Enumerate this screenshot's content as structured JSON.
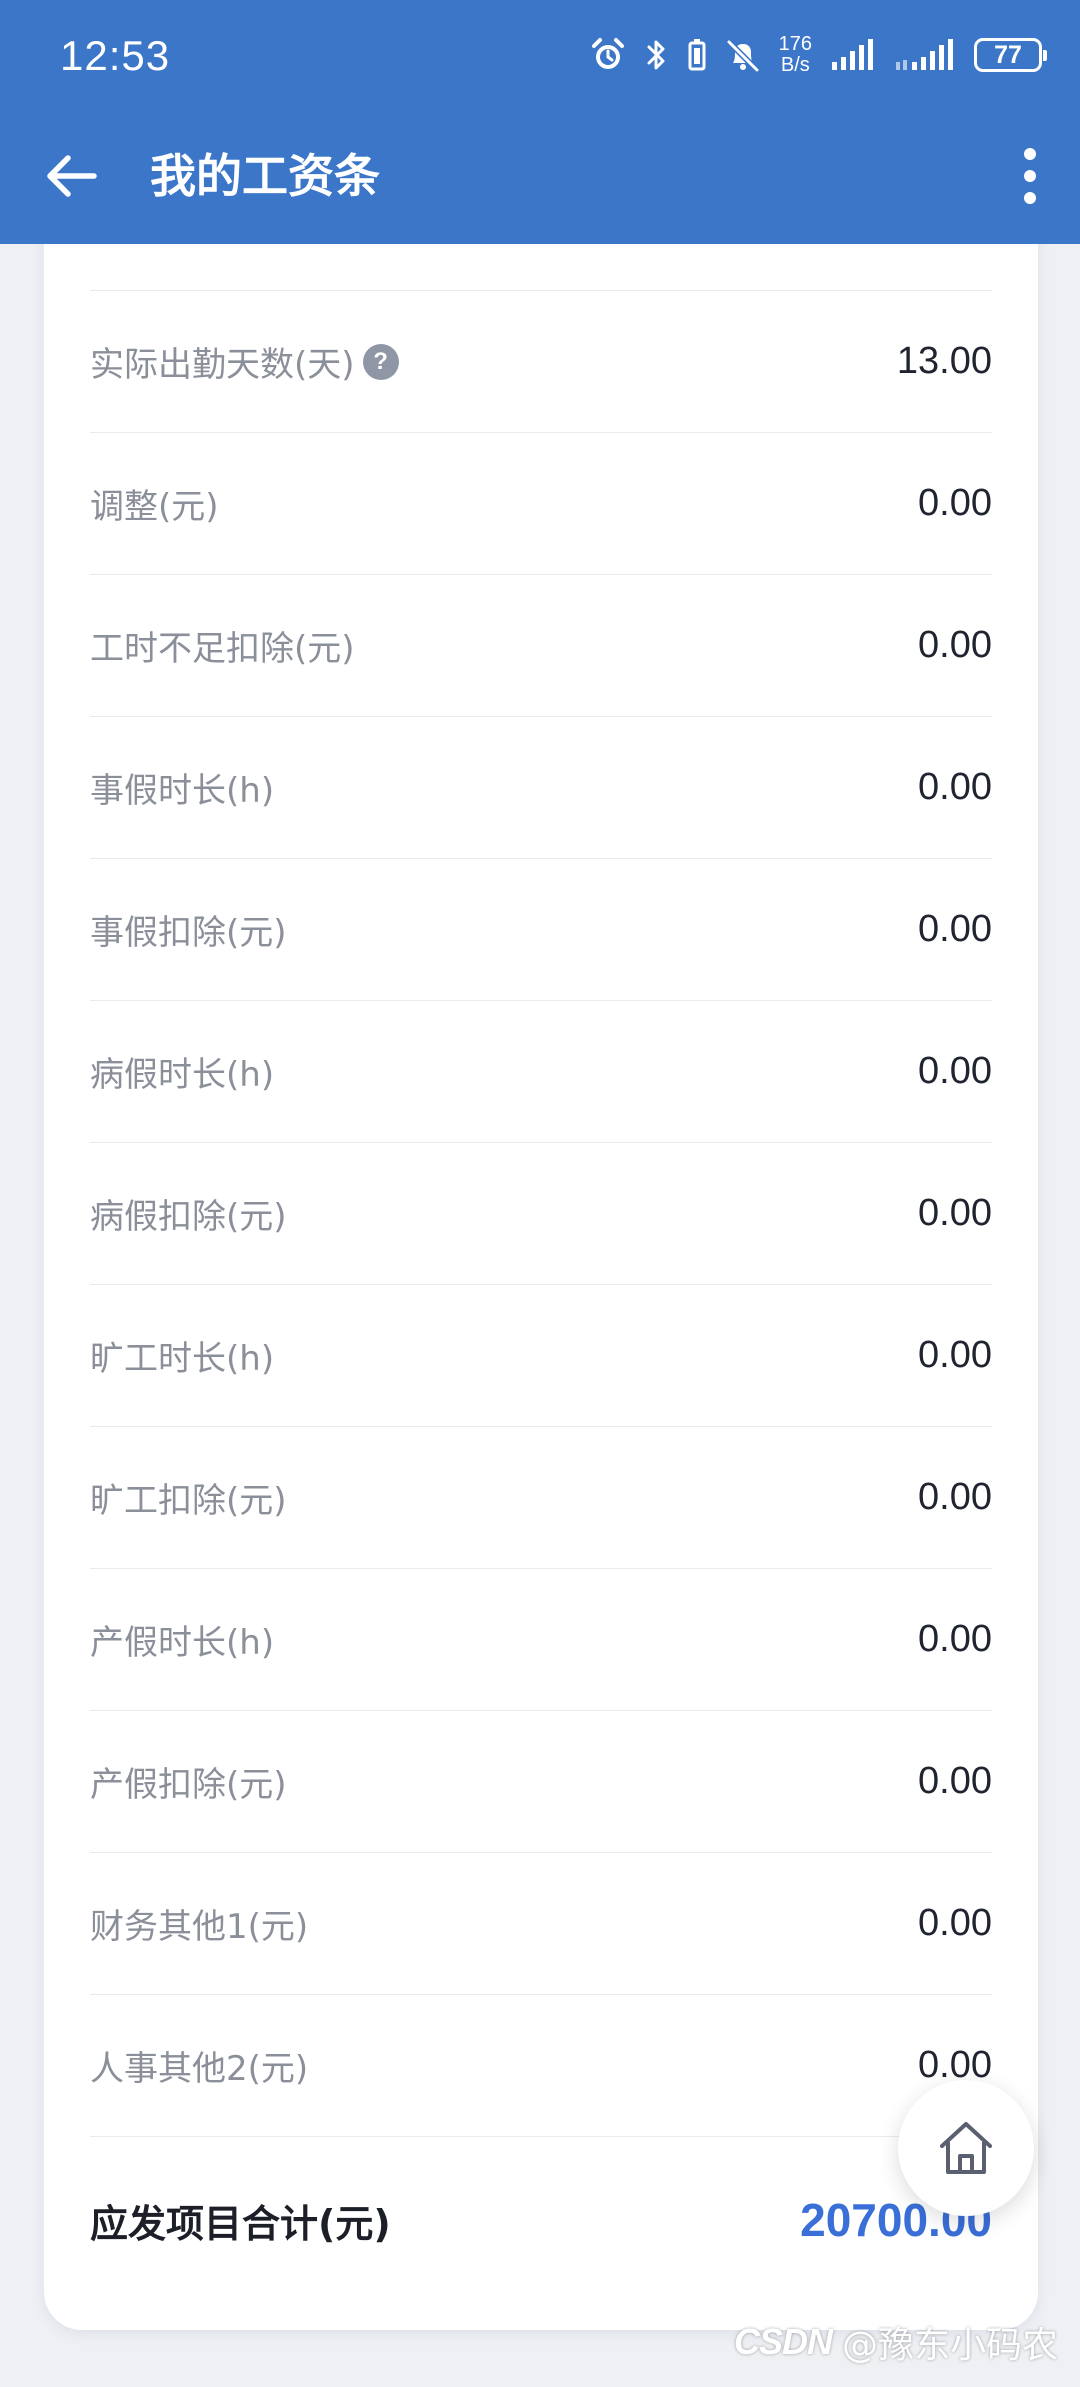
{
  "status_bar": {
    "time": "12:53",
    "net_speed_value": "176",
    "net_speed_unit": "B/s",
    "battery": "77",
    "icons": [
      "alarm-icon",
      "bluetooth-icon",
      "battery-saver-icon",
      "mute-bell-icon",
      "signal-icon",
      "signal-icon-2"
    ]
  },
  "header": {
    "title": "我的工资条",
    "back_icon": "arrow-left-icon",
    "more_icon": "more-vertical-icon"
  },
  "salary_items": [
    {
      "label": "实际出勤天数(天)",
      "value": "13.00",
      "has_help": true
    },
    {
      "label": "调整(元)",
      "value": "0.00"
    },
    {
      "label": "工时不足扣除(元)",
      "value": "0.00"
    },
    {
      "label": "事假时长(h)",
      "value": "0.00"
    },
    {
      "label": "事假扣除(元)",
      "value": "0.00"
    },
    {
      "label": "病假时长(h)",
      "value": "0.00"
    },
    {
      "label": "病假扣除(元)",
      "value": "0.00"
    },
    {
      "label": "旷工时长(h)",
      "value": "0.00"
    },
    {
      "label": "旷工扣除(元)",
      "value": "0.00"
    },
    {
      "label": "产假时长(h)",
      "value": "0.00"
    },
    {
      "label": "产假扣除(元)",
      "value": "0.00"
    },
    {
      "label": "财务其他1(元)",
      "value": "0.00"
    },
    {
      "label": "人事其他2(元)",
      "value": "0.00"
    }
  ],
  "help_glyph": "?",
  "total": {
    "label": "应发项目合计(元)",
    "value": "20700.00"
  },
  "home_button": {
    "icon": "home-icon"
  },
  "watermark": {
    "logo": "CSDN",
    "text": "@豫东小码农"
  },
  "colors": {
    "header_bg": "#3b76c8",
    "total_value": "#3a6fd8",
    "page_bg": "#eef0f4"
  }
}
